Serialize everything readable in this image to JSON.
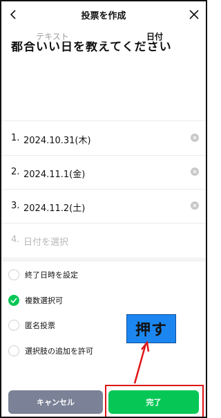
{
  "header": {
    "title": "投票を作成"
  },
  "tabs": [
    {
      "label": "テキスト",
      "active": false
    },
    {
      "label": "日付",
      "active": true
    }
  ],
  "question": "都合いい日を教えてください",
  "options": [
    {
      "number": "1.",
      "value": "2024.10.31(木)"
    },
    {
      "number": "2.",
      "value": "2024.11.1(金)"
    },
    {
      "number": "3.",
      "value": "2024.11.2(土)"
    }
  ],
  "new_option": {
    "number": "4.",
    "placeholder": "日付を選択"
  },
  "settings": [
    {
      "label": "終了日時を設定",
      "checked": false
    },
    {
      "label": "複数選択可",
      "checked": true
    },
    {
      "label": "匿名投票",
      "checked": false
    },
    {
      "label": "選択肢の追加を許可",
      "checked": false
    }
  ],
  "annotation": {
    "callout_text": "押す"
  },
  "footer": {
    "cancel_label": "キャンセル",
    "done_label": "完了"
  },
  "colors": {
    "accent_green": "#06c755",
    "cancel_gray": "#7b8297",
    "callout_blue": "#1c86f0",
    "highlight_red": "#e01515"
  },
  "icons": {
    "back": "chevron-left-icon",
    "close": "close-icon",
    "clear": "clear-circle-icon",
    "check": "checkmark-icon"
  }
}
